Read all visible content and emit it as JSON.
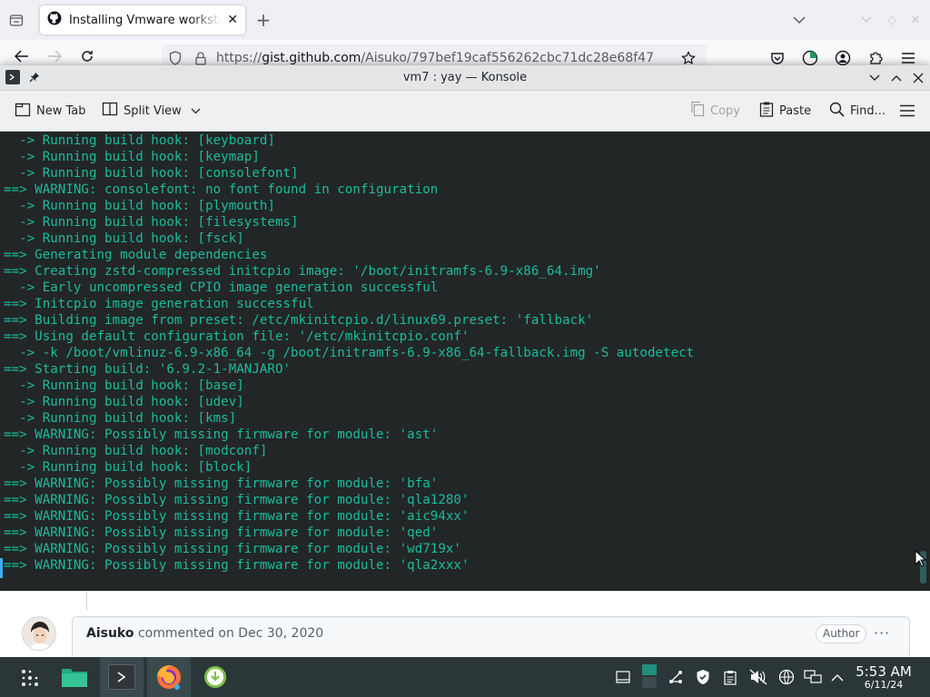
{
  "browser": {
    "tab_title": "Installing Vmware workstation",
    "url_prefix": "https://",
    "url_domain": "gist.github.com",
    "url_path": "/Aisuko/797bef19caf556262cbc71dc28e68f47"
  },
  "konsole": {
    "title": "vm7 : yay — Konsole",
    "toolbar": {
      "new_tab": "New Tab",
      "split_view": "Split View",
      "copy": "Copy",
      "paste": "Paste",
      "find": "Find..."
    },
    "lines": [
      "  -> Running build hook: [keyboard]",
      "  -> Running build hook: [keymap]",
      "  -> Running build hook: [consolefont]",
      "==> WARNING: consolefont: no font found in configuration",
      "  -> Running build hook: [plymouth]",
      "  -> Running build hook: [filesystems]",
      "  -> Running build hook: [fsck]",
      "==> Generating module dependencies",
      "==> Creating zstd-compressed initcpio image: '/boot/initramfs-6.9-x86_64.img'",
      "  -> Early uncompressed CPIO image generation successful",
      "==> Initcpio image generation successful",
      "==> Building image from preset: /etc/mkinitcpio.d/linux69.preset: 'fallback'",
      "==> Using default configuration file: '/etc/mkinitcpio.conf'",
      "  -> -k /boot/vmlinuz-6.9-x86_64 -g /boot/initramfs-6.9-x86_64-fallback.img -S autodetect",
      "==> Starting build: '6.9.2-1-MANJARO'",
      "  -> Running build hook: [base]",
      "  -> Running build hook: [udev]",
      "  -> Running build hook: [kms]",
      "==> WARNING: Possibly missing firmware for module: 'ast'",
      "  -> Running build hook: [modconf]",
      "  -> Running build hook: [block]",
      "==> WARNING: Possibly missing firmware for module: 'bfa'",
      "==> WARNING: Possibly missing firmware for module: 'qla1280'",
      "==> WARNING: Possibly missing firmware for module: 'aic94xx'",
      "==> WARNING: Possibly missing firmware for module: 'qed'",
      "==> WARNING: Possibly missing firmware for module: 'wd719x'",
      "==> WARNING: Possibly missing firmware for module: 'qla2xxx'"
    ]
  },
  "comment": {
    "author": "Aisuko",
    "text": "commented on Dec 30, 2020",
    "badge": "Author",
    "more": "···"
  },
  "taskbar": {
    "time": "5:53 AM",
    "date": "6/11/24"
  },
  "colors": {
    "terminal_bg": "#232627",
    "terminal_fg": "#1abc9c",
    "taskbar_bg": "#2b3638"
  }
}
